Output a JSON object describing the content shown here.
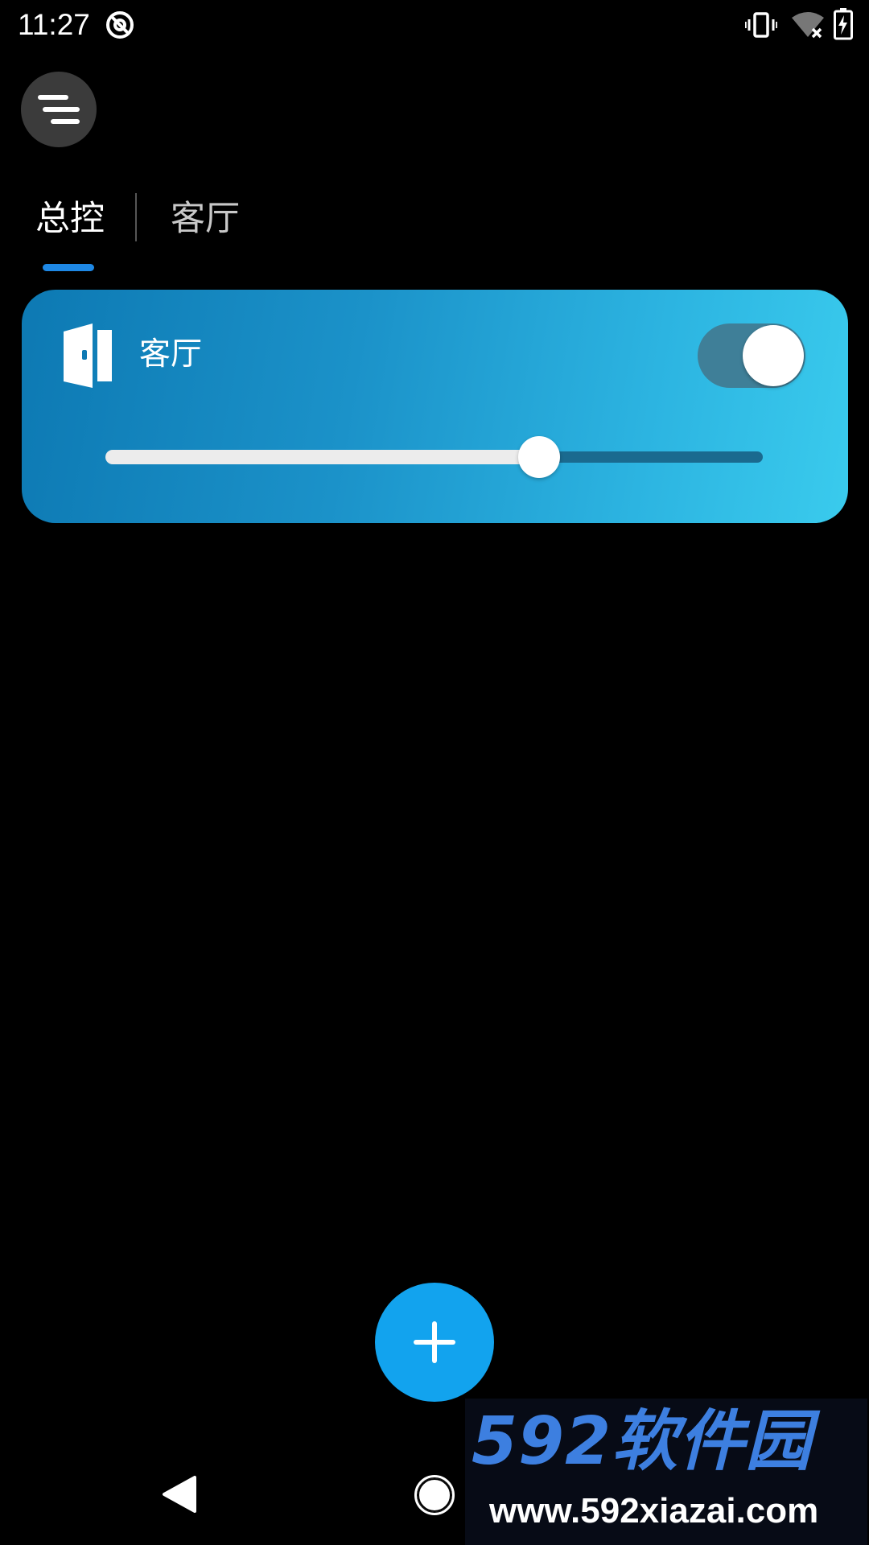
{
  "status_bar": {
    "time": "11:27",
    "icons": [
      "do-not-disturb-icon",
      "vibrate-icon",
      "wifi-off-icon",
      "battery-charging-icon"
    ]
  },
  "header": {
    "menu_icon": "menu-icon"
  },
  "tabs": [
    {
      "label": "总控",
      "active": true
    },
    {
      "label": "客厅",
      "active": false
    }
  ],
  "room_card": {
    "name": "客厅",
    "icon": "door-icon",
    "switch_on": true,
    "slider_value": 0.66,
    "gradient_colors": [
      "#0d79b3",
      "#3acbed"
    ]
  },
  "fab": {
    "icon": "plus-icon",
    "color": "#12a3ee"
  },
  "watermark": {
    "brand": "592软件园",
    "url": "www.592xiazai.com"
  },
  "nav_bar": {
    "icons": [
      "back-icon",
      "home-icon"
    ]
  },
  "colors": {
    "background": "#000000",
    "tab_indicator": "#1e88e5"
  }
}
